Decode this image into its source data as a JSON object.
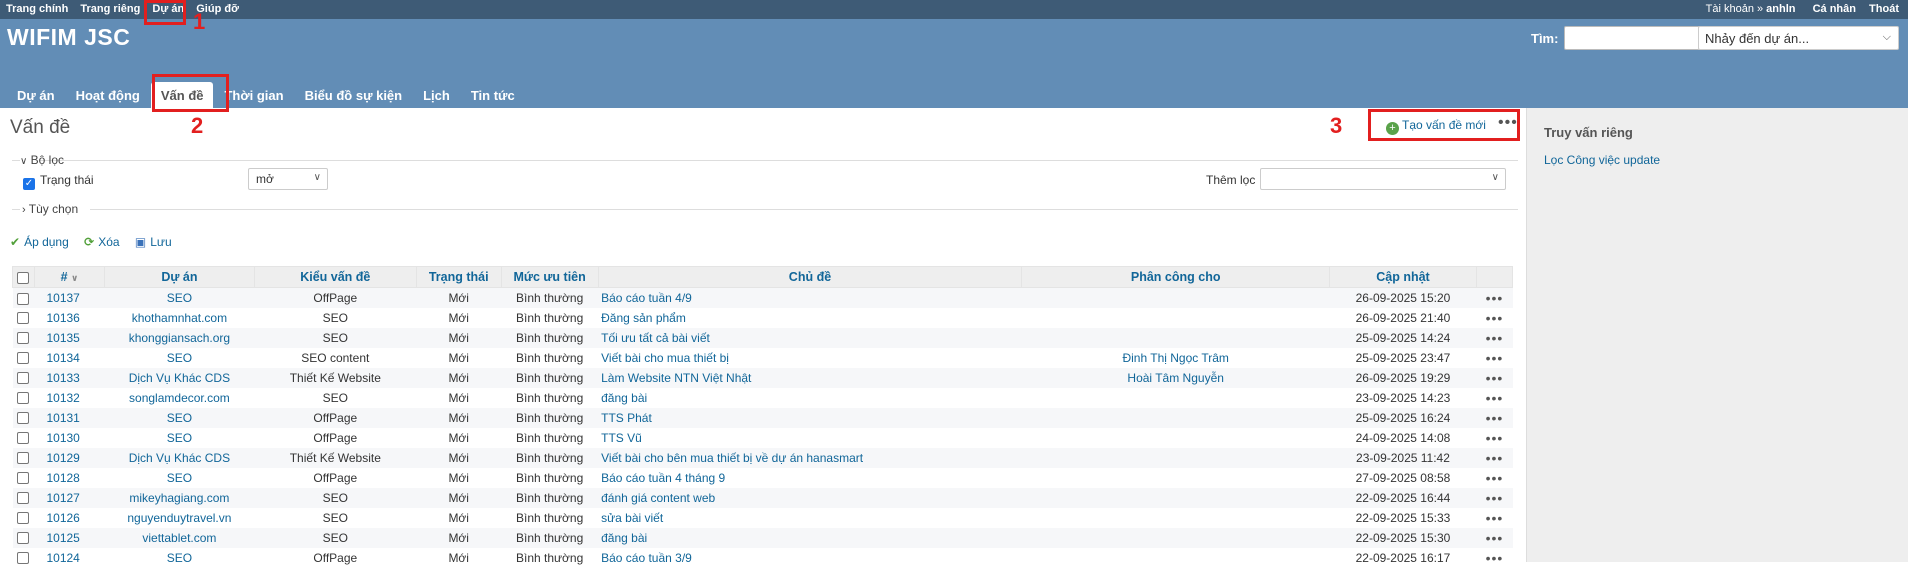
{
  "top_menu": {
    "items": [
      "Trang chính",
      "Trang riêng",
      "Dự án",
      "Giúp đỡ"
    ],
    "account_label": "Tài khoản »",
    "account_user": "anhln",
    "personal": "Cá nhân",
    "logout": "Thoát"
  },
  "header": {
    "title": "WIFIM JSC",
    "search_label": "Tìm:",
    "jump_placeholder": "Nhảy đến dự án..."
  },
  "main_menu": {
    "tabs": [
      "Dự án",
      "Hoạt động",
      "Vấn đề",
      "Thời gian",
      "Biểu đồ sự kiện",
      "Lịch",
      "Tin tức"
    ],
    "selected": "Vấn đề"
  },
  "content": {
    "title": "Vấn đề",
    "new_issue": "Tạo vấn đề mới",
    "filters_legend": "Bộ lọc",
    "status_label": "Trạng thái",
    "status_op": "mở",
    "add_filter_label": "Thêm lọc",
    "options_legend": "Tùy chọn",
    "apply": "Áp dụng",
    "clear": "Xóa",
    "save": "Lưu"
  },
  "annotations": [
    "1",
    "2",
    "3"
  ],
  "table": {
    "columns": [
      "#",
      "Dự án",
      "Kiểu vấn đề",
      "Trạng thái",
      "Mức ưu tiên",
      "Chủ đề",
      "Phân công cho",
      "Cập nhật"
    ],
    "rows": [
      [
        "10137",
        "SEO",
        "OffPage",
        "Mới",
        "Bình thường",
        "Báo cáo tuần 4/9",
        "",
        "26-09-2025 15:20"
      ],
      [
        "10136",
        "khothamnhat.com",
        "SEO",
        "Mới",
        "Bình thường",
        "Đăng sản phẩm",
        "",
        "26-09-2025 21:40"
      ],
      [
        "10135",
        "khonggiansach.org",
        "SEO",
        "Mới",
        "Bình thường",
        "Tối ưu tất cả bài viết",
        "",
        "25-09-2025 14:24"
      ],
      [
        "10134",
        "SEO",
        "SEO content",
        "Mới",
        "Bình thường",
        "Viết bài cho mua thiết bị",
        "Đinh Thị Ngọc Trâm",
        "25-09-2025 23:47"
      ],
      [
        "10133",
        "Dịch Vụ Khác CDS",
        "Thiết Kế Website",
        "Mới",
        "Bình thường",
        "Làm Website NTN Việt Nhật",
        "Hoài Tâm Nguyễn",
        "26-09-2025 19:29"
      ],
      [
        "10132",
        "songlamdecor.com",
        "SEO",
        "Mới",
        "Bình thường",
        "đăng bài",
        "",
        "23-09-2025 14:23"
      ],
      [
        "10131",
        "SEO",
        "OffPage",
        "Mới",
        "Bình thường",
        "TTS Phát",
        "",
        "25-09-2025 16:24"
      ],
      [
        "10130",
        "SEO",
        "OffPage",
        "Mới",
        "Bình thường",
        "TTS Vũ",
        "",
        "24-09-2025 14:08"
      ],
      [
        "10129",
        "Dịch Vụ Khác CDS",
        "Thiết Kế Website",
        "Mới",
        "Bình thường",
        "Viết bài cho bên mua thiết bị về dự án hanasmart",
        "",
        "23-09-2025 11:42"
      ],
      [
        "10128",
        "SEO",
        "OffPage",
        "Mới",
        "Bình thường",
        "Báo cáo tuần 4 tháng 9",
        "",
        "27-09-2025 08:58"
      ],
      [
        "10127",
        "mikeyhagiang.com",
        "SEO",
        "Mới",
        "Bình thường",
        "đánh giá content web",
        "",
        "22-09-2025 16:44"
      ],
      [
        "10126",
        "nguyenduytravel.vn",
        "SEO",
        "Mới",
        "Bình thường",
        "sửa bài viết",
        "",
        "22-09-2025 15:33"
      ],
      [
        "10125",
        "viettablet.com",
        "SEO",
        "Mới",
        "Bình thường",
        "đăng bài",
        "",
        "22-09-2025 15:30"
      ],
      [
        "10124",
        "SEO",
        "OffPage",
        "Mới",
        "Bình thường",
        "Báo cáo tuần 3/9",
        "",
        "22-09-2025 16:17"
      ]
    ]
  },
  "sidebar": {
    "title": "Truy vấn riêng",
    "link": "Lọc Công việc update"
  }
}
